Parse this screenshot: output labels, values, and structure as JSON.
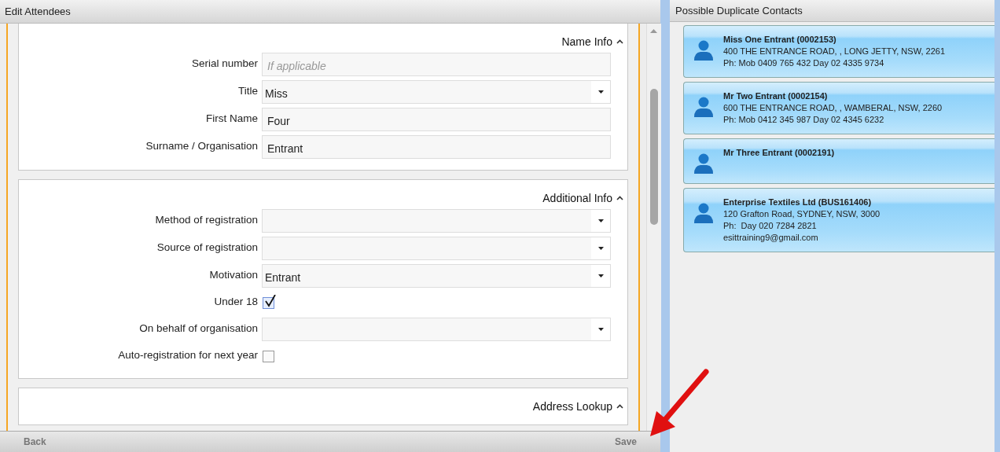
{
  "window": {
    "title": "Edit Attendees"
  },
  "sections": [
    {
      "title": "Name Info",
      "expanded": true,
      "fields": [
        {
          "kind": "text",
          "label": "Serial number",
          "placeholder": "If applicable"
        },
        {
          "kind": "select",
          "label": "Title",
          "value": "Miss"
        },
        {
          "kind": "text",
          "label": "First Name",
          "value": "Four"
        },
        {
          "kind": "text",
          "label": "Surname / Organisation",
          "value": "Entrant"
        }
      ]
    },
    {
      "title": "Additional Info",
      "expanded": true,
      "fields": [
        {
          "kind": "select",
          "label": "Method of registration"
        },
        {
          "kind": "select",
          "label": "Source of registration"
        },
        {
          "kind": "select",
          "label": "Motivation",
          "value": "Entrant"
        },
        {
          "kind": "checkbox",
          "label": "Under 18",
          "checked": true
        },
        {
          "kind": "select",
          "label": "On behalf of organisation"
        },
        {
          "kind": "checkbox",
          "label": "Auto-registration for next year",
          "checked": false
        }
      ]
    },
    {
      "title": "Address Lookup",
      "expanded": true
    }
  ],
  "footer": {
    "back": "Back",
    "save": "Save"
  },
  "duplicates": {
    "title": "Possible Duplicate Contacts",
    "contacts": [
      {
        "name": "Miss One Entrant (0002153)",
        "lines": [
          "400 THE ENTRANCE ROAD, , LONG JETTY, NSW, 2261",
          "Ph: Mob 0409 765 432 Day 02 4335 9734"
        ]
      },
      {
        "name": "Mr Two Entrant (0002154)",
        "lines": [
          "600 THE ENTRANCE ROAD, , WAMBERAL, NSW, 2260",
          "Ph: Mob 0412 345 987 Day 02 4345 6232"
        ]
      },
      {
        "name": "Mr Three Entrant (0002191)"
      },
      {
        "name": "Enterprise Textiles Ltd (BUS161406)",
        "lines": [
          "120 Grafton Road, SYDNEY, NSW, 3000",
          "Ph:  Day 020 7284 2821",
          "esittraining9@gmail.com"
        ]
      }
    ]
  }
}
